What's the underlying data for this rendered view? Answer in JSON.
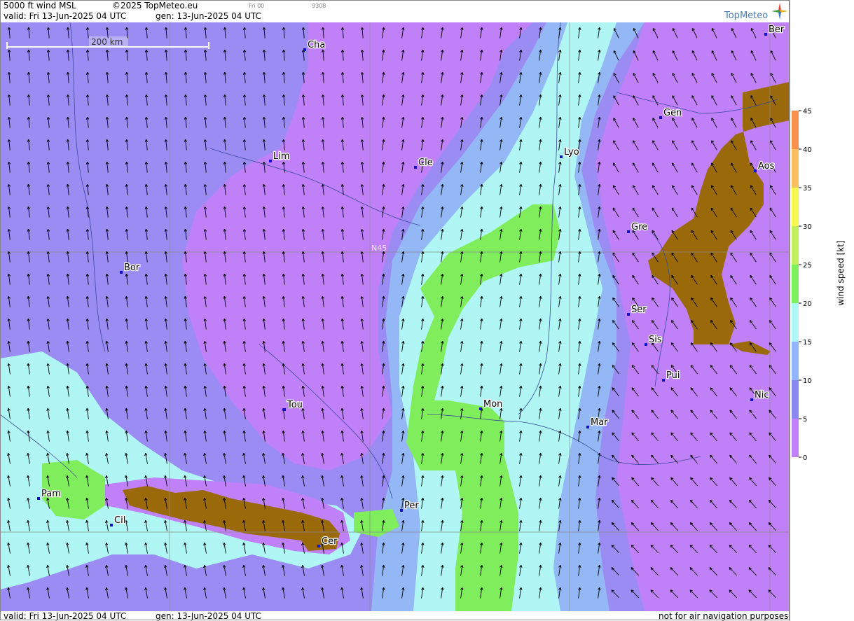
{
  "header": {
    "product": "5000 ft wind MSL",
    "copyright": "©2025 TopMeteo.eu",
    "run": "Fri 00",
    "code": "9308",
    "valid": "valid:  Fri  13-Jun-2025  04 UTC",
    "gen": "gen: 13-Jun-2025  04 UTC",
    "brand": "TopMeteo"
  },
  "footer": {
    "valid": "valid:  Fri  13-Jun-2025  04 UTC",
    "gen": "gen: 13-Jun-2025  04 UTC",
    "disclaimer": "not for air navigation purposes"
  },
  "scale_bar": {
    "label": "200 km"
  },
  "grid_label": "N45",
  "cities": [
    {
      "code": "Cha"
    },
    {
      "code": "Ber"
    },
    {
      "code": "Gen"
    },
    {
      "code": "Lim"
    },
    {
      "code": "Cle"
    },
    {
      "code": "Lyo"
    },
    {
      "code": "Aos"
    },
    {
      "code": "Gre"
    },
    {
      "code": "Bor"
    },
    {
      "code": "Ser"
    },
    {
      "code": "Sis"
    },
    {
      "code": "Pui"
    },
    {
      "code": "Tou"
    },
    {
      "code": "Mon"
    },
    {
      "code": "Mar"
    },
    {
      "code": "Nic"
    },
    {
      "code": "Pam"
    },
    {
      "code": "Cil"
    },
    {
      "code": "Per"
    },
    {
      "code": "Cer"
    }
  ],
  "legend": {
    "title": "wind speed [kt]",
    "ticks": [
      "0",
      "5",
      "10",
      "15",
      "20",
      "25",
      "30",
      "35",
      "40",
      "45"
    ],
    "colors": [
      "#c080f8",
      "#8888f0",
      "#90b8f8",
      "#b0f8f8",
      "#80f060",
      "#c0f060",
      "#f8f850",
      "#f8c060",
      "#f89050",
      "#f07060"
    ]
  },
  "colors": {
    "calm": "#c080f8",
    "light": "#9a8cf2",
    "moderate": "#94b8f6",
    "fresh": "#b0f6f4",
    "strong": "#80ee5c",
    "terrain": "#9a6a0a",
    "water_lines": "#3a4a9a"
  }
}
